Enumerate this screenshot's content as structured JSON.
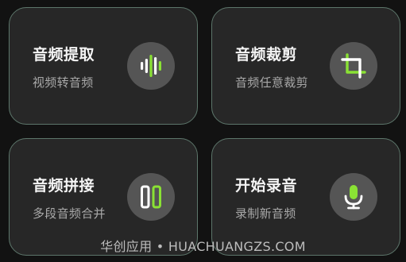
{
  "cards": [
    {
      "title": "音频提取",
      "subtitle": "视频转音频",
      "icon": "sound-wave-icon"
    },
    {
      "title": "音频裁剪",
      "subtitle": "音频任意裁剪",
      "icon": "crop-icon"
    },
    {
      "title": "音频拼接",
      "subtitle": "多段音频合并",
      "icon": "merge-icon"
    },
    {
      "title": "开始录音",
      "subtitle": "录制新音频",
      "icon": "microphone-icon"
    }
  ],
  "watermark": "华创应用 • HUACHUANGZS.COM",
  "colors": {
    "background": "#121212",
    "card": "#272727",
    "card_border": "#5d766b",
    "icon_circle": "#555555",
    "accent_green": "#8ae234",
    "white": "#ffffff"
  }
}
